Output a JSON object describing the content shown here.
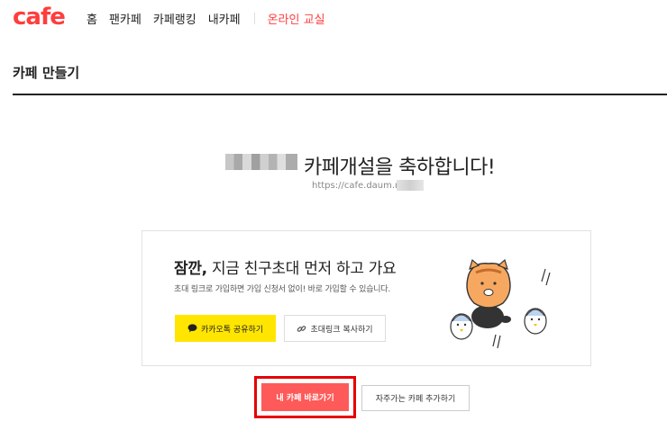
{
  "header": {
    "logo": "cafe",
    "nav": [
      "홈",
      "팬카페",
      "카페랭킹",
      "내카페"
    ],
    "online_class": "온라인 교실",
    "accent_color": "#ff3d3d"
  },
  "page": {
    "title": "카페 만들기"
  },
  "congrats": {
    "message": "카페개설을 축하합니다!",
    "url": "https://cafe.daum.net"
  },
  "invite": {
    "title_bold": "잠깐,",
    "title_rest": " 지금 친구초대 먼저 하고 가요",
    "description": "초대 링크로 가입하면 가입 신청서 없이! 바로 가입할 수 있습니다.",
    "kakao_button": "카카오톡 공유하기",
    "copy_link_button": "초대링크 복사하기",
    "kakao_color": "#ffe500"
  },
  "actions": {
    "go_to_cafe": "내 카페 바로가기",
    "add_favorite": "자주가는 카페 추가하기",
    "go_color": "#ff5a5a"
  }
}
